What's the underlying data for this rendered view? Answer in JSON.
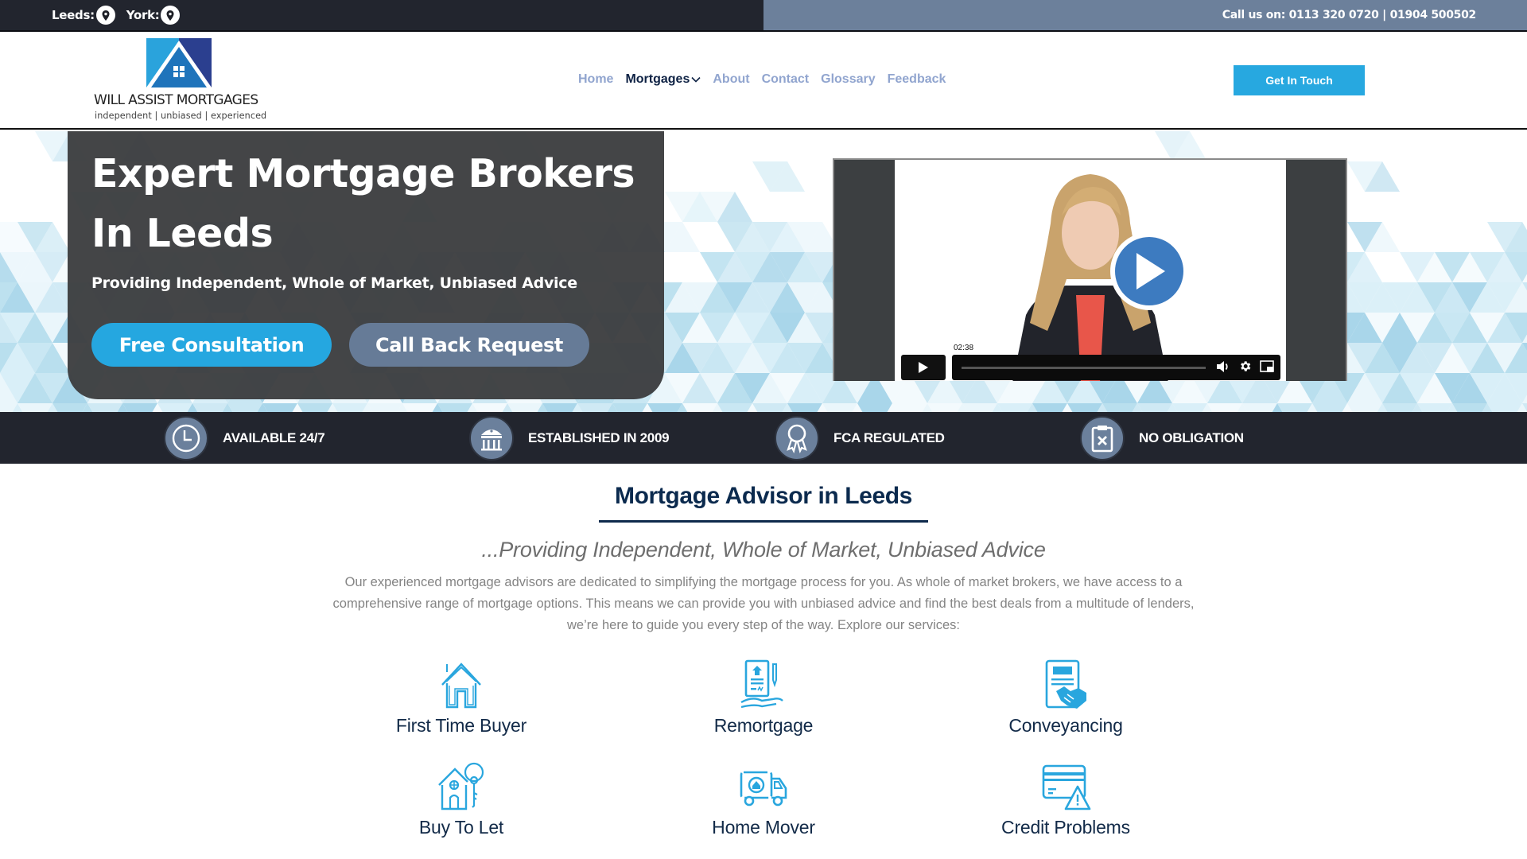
{
  "topbar": {
    "locations": [
      {
        "label": "Leeds:",
        "icon": "map-pin-icon"
      },
      {
        "label": "York:",
        "icon": "map-pin-icon"
      }
    ],
    "call_text": "Call us on: 0113 320 0720 | 01904 500502"
  },
  "brand": {
    "name": "WILL ASSIST MORTGAGES",
    "tagline": "independent | unbiased | experienced"
  },
  "nav": {
    "items": [
      {
        "label": "Home",
        "active": false
      },
      {
        "label": "Mortgages",
        "active": true,
        "has_dropdown": true
      },
      {
        "label": "About",
        "active": false
      },
      {
        "label": "Contact",
        "active": false
      },
      {
        "label": "Glossary",
        "active": false
      },
      {
        "label": "Feedback",
        "active": false
      }
    ],
    "cta_label": "Get In Touch"
  },
  "hero": {
    "title": "Expert Mortgage Brokers In Leeds",
    "subtitle": "Providing Independent, Whole of Market, Unbiased Advice",
    "primary_button": "Free Consultation",
    "secondary_button": "Call Back Request",
    "video": {
      "duration": "02:38"
    }
  },
  "features": [
    {
      "label": "AVAILABLE 24/7",
      "icon": "clock-icon"
    },
    {
      "label": "ESTABLISHED IN 2009",
      "icon": "bank-building-icon"
    },
    {
      "label": "FCA REGULATED",
      "icon": "award-ribbon-icon"
    },
    {
      "label": "NO OBLIGATION",
      "icon": "clipboard-x-icon"
    }
  ],
  "section": {
    "title": "Mortgage Advisor in Leeds",
    "subtitle": "...Providing Independent, Whole of Market, Unbiased Advice",
    "body": "Our experienced mortgage advisors are dedicated to simplifying the mortgage process for you. As whole of market brokers, we have access to a comprehensive range of mortgage options. This means we can provide you with unbiased advice and find the best deals from a multitude of lenders, we’re here to guide you every step of the way. Explore our services:"
  },
  "services": [
    {
      "label": "First Time Buyer",
      "icon": "house-outline-icon"
    },
    {
      "label": "Remortgage",
      "icon": "document-hand-icon"
    },
    {
      "label": "Conveyancing",
      "icon": "contract-handshake-icon"
    },
    {
      "label": "Buy To Let",
      "icon": "house-key-icon"
    },
    {
      "label": "Home Mover",
      "icon": "moving-truck-icon"
    },
    {
      "label": "Credit Problems",
      "icon": "credit-card-warning-icon"
    }
  ],
  "colors": {
    "accent": "#27a8e0",
    "dark": "#22252e",
    "slate": "#6c809b",
    "navy": "#0b2a4e"
  }
}
